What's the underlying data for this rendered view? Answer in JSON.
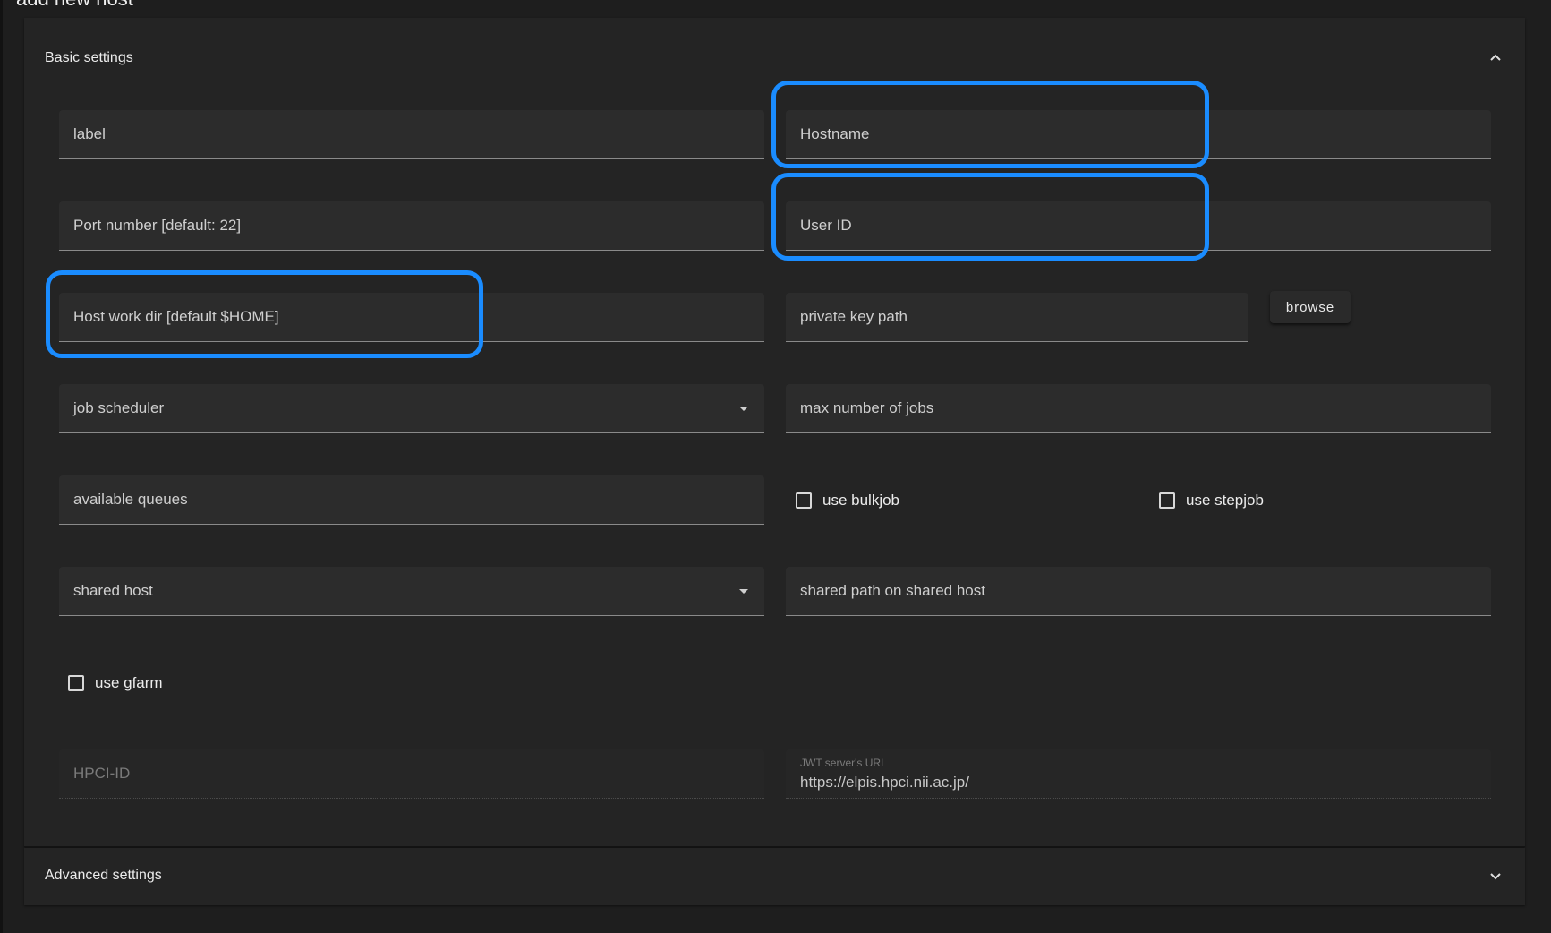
{
  "dialog": {
    "title": "add new host"
  },
  "basic_settings": {
    "title": "Basic settings",
    "fields": {
      "label": "label",
      "hostname": "Hostname",
      "port": "Port number [default: 22]",
      "user_id": "User ID",
      "host_work_dir": "Host work dir [default $HOME]",
      "private_key_path": "private key path",
      "job_scheduler": "job scheduler",
      "max_jobs": "max number of jobs",
      "available_queues": "available queues",
      "shared_host": "shared host",
      "shared_path": "shared path on shared host",
      "hpci_id": "HPCI-ID",
      "jwt_label": "JWT server's URL",
      "jwt_value": "https://elpis.hpci.nii.ac.jp/"
    },
    "checkboxes": {
      "use_bulkjob": "use bulkjob",
      "use_stepjob": "use stepjob",
      "use_gfarm": "use gfarm"
    },
    "browse_label": "browse"
  },
  "advanced_settings": {
    "title": "Advanced settings"
  },
  "highlight_color": "#1a8cff",
  "icons": [
    "chevron-up-icon",
    "chevron-down-icon",
    "dropdown-arrow-icon",
    "checkbox-icon"
  ]
}
